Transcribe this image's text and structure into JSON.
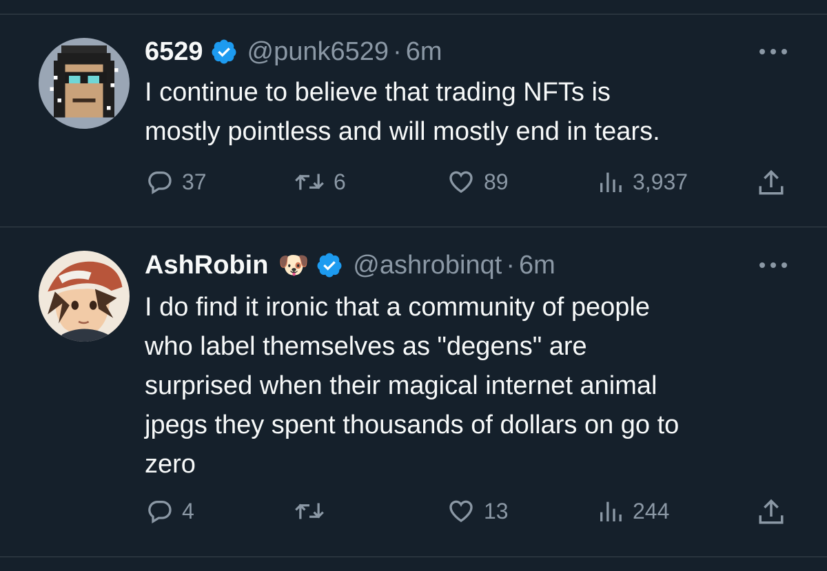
{
  "tweets": [
    {
      "name": "6529",
      "handle": "@punk6529",
      "separator": "·",
      "time": "6m",
      "text_lines": [
        "I continue to believe that trading NFTs is",
        "mostly pointless and will mostly end in tears."
      ],
      "replies": "37",
      "retweets": "6",
      "likes": "89",
      "views": "3,937",
      "avatar_icon": "pixel-punk-avatar"
    },
    {
      "name": "AshRobin",
      "name_emoji": "🐶",
      "handle": "@ashrobinqt",
      "separator": "·",
      "time": "6m",
      "text_lines": [
        "I do find it ironic that a community of people",
        "who label themselves as \"degens\" are",
        "surprised when their magical internet animal",
        "jpegs they spent thousands of dollars on go to",
        "zero"
      ],
      "replies": "4",
      "retweets": "",
      "likes": "13",
      "views": "244",
      "avatar_icon": "anime-trainer-avatar"
    }
  ],
  "colors": {
    "background": "#15202b",
    "text": "#f7f9f9",
    "secondary": "#8b98a5",
    "verified": "#1d9bf0",
    "divider": "#38444d"
  }
}
